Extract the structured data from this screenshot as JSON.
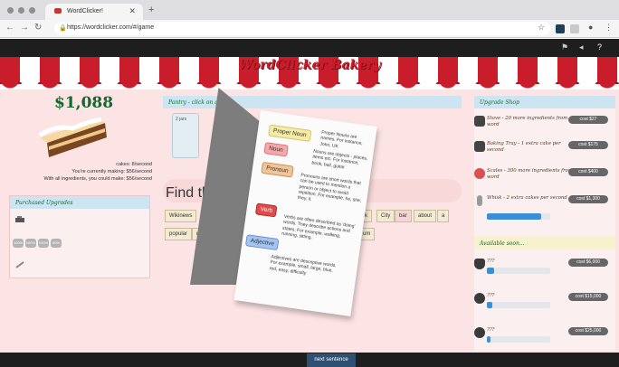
{
  "browser": {
    "tab_title": "WordClicker!",
    "url": "https://wordclicker.com/#/game"
  },
  "game": {
    "logo": "WordClicker Bakery",
    "money": "$1,088",
    "stats": [
      "cakes: 8/second",
      "You're currently making: $56/second",
      "With all ingredients, you could make: $56/second"
    ],
    "purchased_title": "Purchased Upgrades",
    "upg_labels": [
      "100%",
      "100%",
      "100%",
      "50%"
    ],
    "pantry_title": "Pantry - click on an i",
    "jar_label": "2 jars",
    "find_text": "Find th",
    "words_row1": [
      "Wikinews",
      "k",
      "City",
      "bar",
      "about",
      "a"
    ],
    "words_row2": [
      "popular",
      "ne",
      "um"
    ],
    "next_button": "next sentence",
    "shop_title": "Upgrade Shop",
    "shop_items": [
      {
        "text": "Stove - 20 more ingredients from word",
        "cost": "cost $27"
      },
      {
        "text": "Baking Tray - 1 extra cake per second",
        "cost": "cost $175"
      },
      {
        "text": "Scales - 300 more ingredients from word",
        "cost": "cost $400"
      },
      {
        "text": "Whisk - 2 extra cakes per second",
        "cost": "cost $1,300",
        "progress": 0.85
      }
    ],
    "avail_title": "Available soon...",
    "soon_items": [
      {
        "text": "???",
        "cost": "cost $6,000",
        "progress": 0.12
      },
      {
        "text": "???",
        "cost": "cost $15,000",
        "progress": 0.08
      },
      {
        "text": "???",
        "cost": "cost $25,000",
        "progress": 0.05
      }
    ]
  },
  "book": {
    "proper_noun": "Proper Noun",
    "proper_noun_def": "Proper Nouns are names. For instance, John, UK",
    "noun": "Noun",
    "noun_def": "Nouns are objects - places, items etc. For instance, book, ball, guitar",
    "pronoun": "Pronoun",
    "pronoun_def": "Pronouns are short words that can be used to mention a person or object to avoid repitition. For example, he, she, they, it.",
    "verb": "Verb",
    "verb_def": "Verbs are often described as 'doing' words. They describe actions and states. For example, walking, running, sitting.",
    "adjective": "Adjective",
    "adjective_def": "Adjectives are descriptive words. For example, small, large, blue, red, easy, difficulty"
  }
}
